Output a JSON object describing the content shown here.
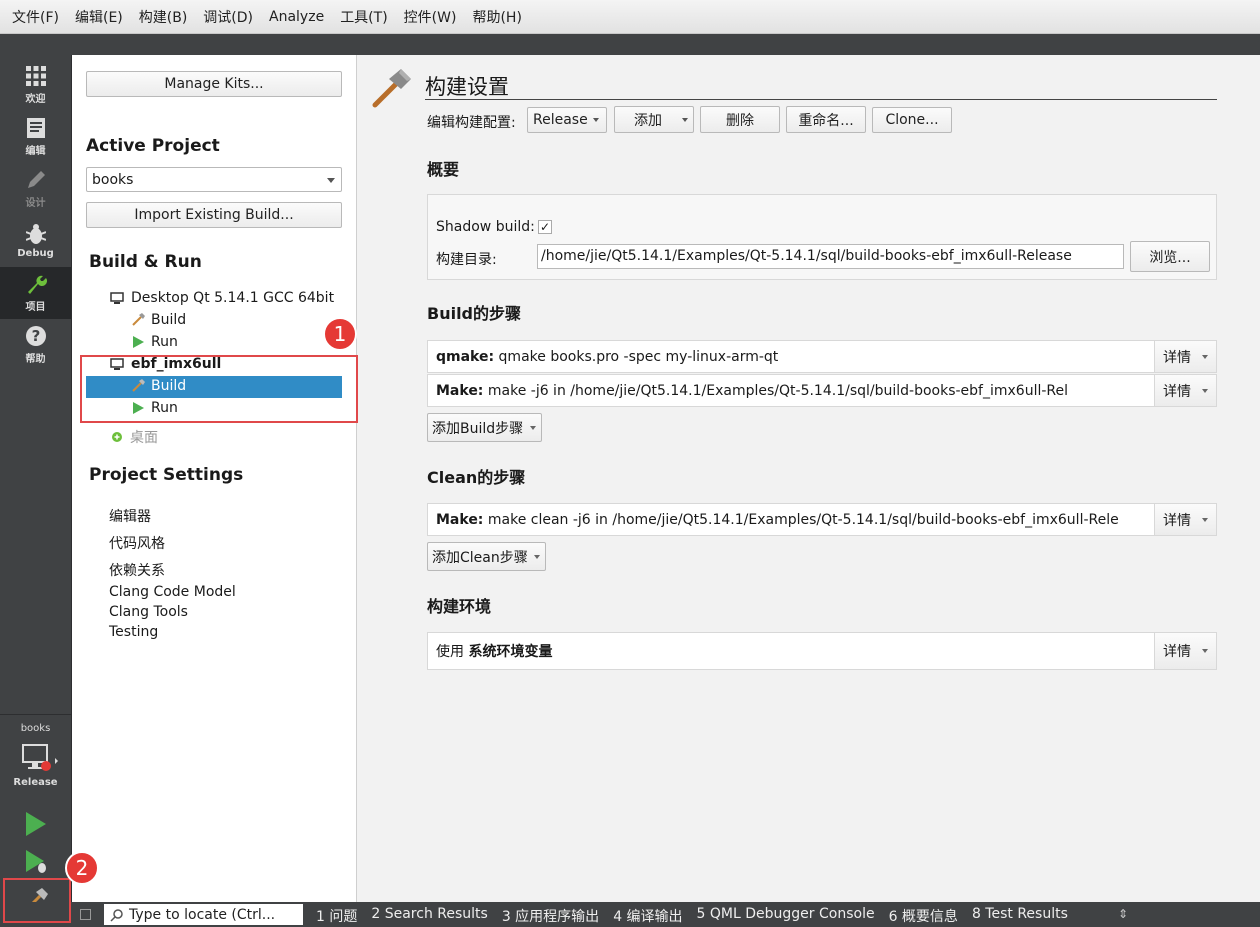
{
  "menu": [
    {
      "label": "文件(F)"
    },
    {
      "label": "编辑(E)"
    },
    {
      "label": "构建(B)"
    },
    {
      "label": "调试(D)"
    },
    {
      "label": "Analyze"
    },
    {
      "label": "工具(T)"
    },
    {
      "label": "控件(W)"
    },
    {
      "label": "帮助(H)"
    }
  ],
  "modes": {
    "welcome": "欢迎",
    "edit": "编辑",
    "design": "设计",
    "debug": "Debug",
    "projects": "项目",
    "help": "帮助"
  },
  "target": {
    "project": "books",
    "config": "Release"
  },
  "sidebar": {
    "manage_kits": "Manage Kits...",
    "active_project_heading": "Active Project",
    "project_selected": "books",
    "import_build": "Import Existing Build...",
    "build_run_heading": "Build & Run",
    "kits": [
      {
        "name": "Desktop Qt 5.14.1 GCC 64bit",
        "build": "Build",
        "run": "Run"
      },
      {
        "name": "ebf_imx6ull",
        "build": "Build",
        "run": "Run"
      }
    ],
    "desktop_inactive": "桌面",
    "project_settings_heading": "Project Settings",
    "settings": [
      "编辑器",
      "代码风格",
      "依赖关系",
      "Clang Code Model",
      "Clang Tools",
      "Testing"
    ]
  },
  "main": {
    "title": "构建设置",
    "edit_config_label": "编辑构建配置:",
    "config_value": "Release",
    "add_label": "添加",
    "delete_label": "删除",
    "rename_label": "重命名...",
    "clone_label": "Clone...",
    "overview_heading": "概要",
    "shadow_build_label": "Shadow build:",
    "shadow_build_checked": "✓",
    "build_dir_label": "构建目录:",
    "build_dir_value": "/home/jie/Qt5.14.1/Examples/Qt-5.14.1/sql/build-books-ebf_imx6ull-Release",
    "browse_label": "浏览...",
    "build_steps_heading": "Build的步骤",
    "build_steps": [
      {
        "key": "qmake:",
        "text": " qmake books.pro -spec my-linux-arm-qt",
        "detail": "详情"
      },
      {
        "key": "Make:",
        "text": " make -j6 in /home/jie/Qt5.14.1/Examples/Qt-5.14.1/sql/build-books-ebf_imx6ull-Rel",
        "detail": "详情"
      }
    ],
    "add_build_step": "添加Build步骤",
    "clean_steps_heading": "Clean的步骤",
    "clean_steps": [
      {
        "key": "Make:",
        "text": " make clean -j6 in /home/jie/Qt5.14.1/Examples/Qt-5.14.1/sql/build-books-ebf_imx6ull-Rele",
        "detail": "详情"
      }
    ],
    "add_clean_step": "添加Clean步骤",
    "env_heading": "构建环境",
    "env_prefix": "使用 ",
    "env_bold": "系统环境变量",
    "env_detail": "详情"
  },
  "statusbar": {
    "locate_placeholder": "Type to locate (Ctrl...",
    "panes": [
      "1  问题",
      "2  Search Results",
      "3  应用程序输出",
      "4  编译输出",
      "5  QML Debugger Console",
      "6  概要信息",
      "8  Test Results"
    ]
  },
  "annotations": [
    "1",
    "2"
  ],
  "colors": {
    "selection": "#308cc6",
    "modebar": "#404244",
    "annotation_red": "#e53935",
    "run_green": "#4caf50"
  }
}
